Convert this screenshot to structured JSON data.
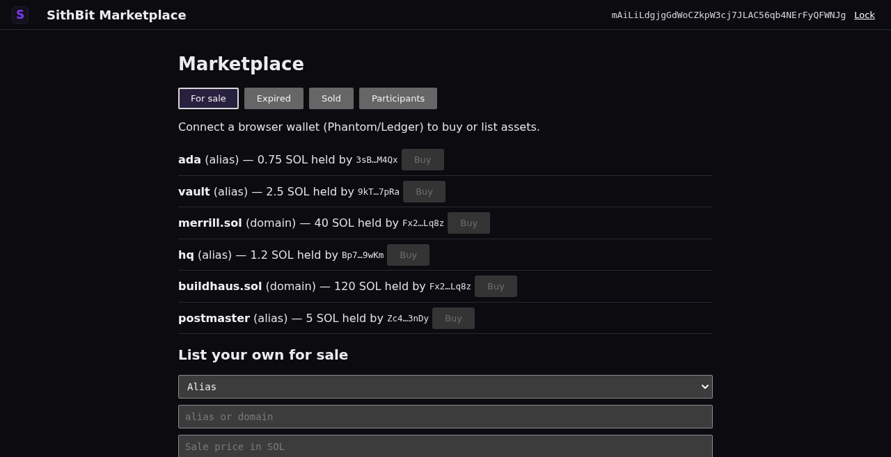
{
  "header": {
    "logo": "S",
    "title": "SithBit Marketplace",
    "wallet_address": "mAiLiLdgjgGdWoCZkpW3cj7JLAC56qb4NErFyQFWNJg",
    "lock_link": "Lock"
  },
  "page": {
    "heading": "Marketplace",
    "tabs": [
      {
        "label": "For sale",
        "selected": true
      },
      {
        "label": "Expired",
        "selected": false
      },
      {
        "label": "Sold",
        "selected": false
      },
      {
        "label": "Participants",
        "selected": false
      }
    ],
    "notice": "Connect a browser wallet (Phantom/Ledger) to buy or list assets.",
    "listings": [
      {
        "text": "**ada** (alias) — 0.75 SOL held by",
        "holder": "3sB…M4Qx",
        "buy": {
          "label": "Buy",
          "disabled": true
        }
      },
      {
        "text": "**vault** (alias) — 2.5 SOL held by",
        "holder": "9kT…7pRa",
        "buy": {
          "label": "Buy",
          "disabled": true
        }
      },
      {
        "text": "**merrill.sol** (domain) — 40 SOL held by",
        "holder": "Fx2…Lq8z",
        "buy": {
          "label": "Buy",
          "disabled": true
        }
      },
      {
        "text": "**hq** (alias) — 1.2 SOL held by",
        "holder": "Bp7…9wKm",
        "buy": {
          "label": "Buy",
          "disabled": true
        }
      },
      {
        "text": "**buildhaus.sol** (domain) — 120 SOL held by",
        "holder": "Fx2…Lq8z",
        "buy": {
          "label": "Buy",
          "disabled": true
        }
      },
      {
        "text": "**postmaster** (alias) — 5 SOL held by",
        "holder": "Zc4…3nDy",
        "buy": {
          "label": "Buy",
          "disabled": true
        }
      }
    ],
    "list_form": {
      "heading": "List your own for sale",
      "asset_type_select": {
        "value": "Alias"
      },
      "name_field": {
        "placeholder": "alias or domain"
      },
      "price_field": {
        "placeholder": "Sale price in SOL"
      }
    }
  }
}
